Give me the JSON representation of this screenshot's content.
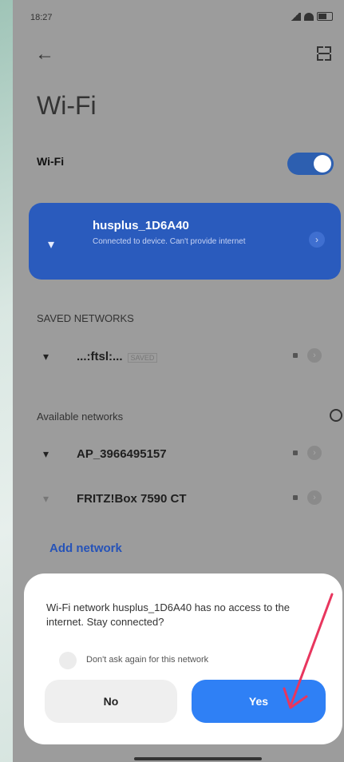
{
  "status_bar": {
    "time": "18:27"
  },
  "header": {
    "back_icon": "arrow-left-icon",
    "scan_icon": "qr-scan-icon"
  },
  "page_title": "Wi-Fi",
  "wifi_toggle": {
    "label": "Wi-Fi",
    "enabled": true
  },
  "connected_network": {
    "ssid": "husplus_1D6A40",
    "status": "Connected to device. Can't provide internet"
  },
  "saved_networks": {
    "header": "SAVED NETWORKS",
    "items": [
      {
        "name": "...:ftsl:...",
        "tag": "SAVED"
      }
    ]
  },
  "available_networks": {
    "header": "Available networks",
    "items": [
      {
        "name": "AP_3966495157"
      },
      {
        "name": "FRITZ!Box 7590 CT"
      }
    ]
  },
  "add_network_label": "Add network",
  "dialog": {
    "message": "Wi-Fi network husplus_1D6A40 has no access to the internet. Stay connected?",
    "checkbox_label": "Don't ask again for this network",
    "no_label": "No",
    "yes_label": "Yes"
  },
  "colors": {
    "accent": "#2f80f5",
    "arrow": "#e8365e"
  }
}
